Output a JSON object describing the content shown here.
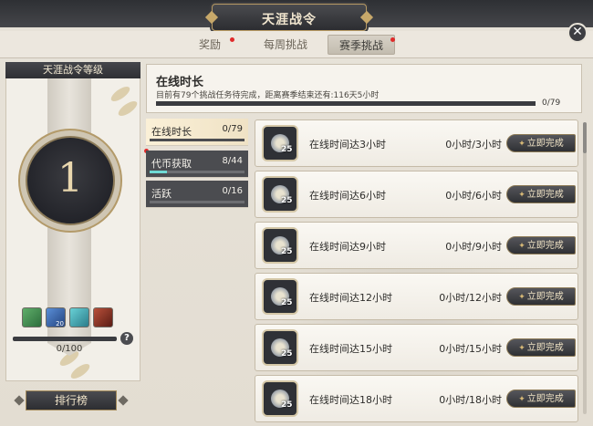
{
  "window": {
    "title": "天涯战令",
    "close_symbol": "✕"
  },
  "tabs": [
    {
      "label": "奖励",
      "active": false,
      "has_dot": true
    },
    {
      "label": "每周挑战",
      "active": false,
      "has_dot": false
    },
    {
      "label": "赛季挑战",
      "active": true,
      "has_dot": true
    }
  ],
  "level_panel": {
    "header": "天涯战令等级",
    "level": "1",
    "rewards": [
      {
        "icon": "green-scroll-icon",
        "count": ""
      },
      {
        "icon": "blue-gem-icon",
        "count": "20"
      },
      {
        "icon": "cyan-scroll-icon",
        "count": ""
      },
      {
        "icon": "red-chest-icon",
        "count": ""
      }
    ],
    "exp_text": "0/100",
    "exp_fraction": 0,
    "help_symbol": "?",
    "rank_button": "排行榜"
  },
  "summary": {
    "title": "在线时长",
    "description": "目前有79个挑战任务待完成，距离赛季结束还有:116天5小时",
    "progress_text": "0/79",
    "progress_fraction": 0
  },
  "categories": [
    {
      "label": "在线时长",
      "value": "0/79",
      "fraction": 0,
      "active": true,
      "has_dot": false
    },
    {
      "label": "代币获取",
      "value": "8/44",
      "fraction": 0.18,
      "active": false,
      "has_dot": true
    },
    {
      "label": "活跃",
      "value": "0/16",
      "fraction": 0,
      "active": false,
      "has_dot": false
    }
  ],
  "quests": [
    {
      "name": "在线时间达3小时",
      "progress": "0小时/3小时",
      "reward": "25",
      "button": "立即完成"
    },
    {
      "name": "在线时间达6小时",
      "progress": "0小时/6小时",
      "reward": "25",
      "button": "立即完成"
    },
    {
      "name": "在线时间达9小时",
      "progress": "0小时/9小时",
      "reward": "25",
      "button": "立即完成"
    },
    {
      "name": "在线时间达12小时",
      "progress": "0小时/12小时",
      "reward": "25",
      "button": "立即完成"
    },
    {
      "name": "在线时间达15小时",
      "progress": "0小时/15小时",
      "reward": "25",
      "button": "立即完成"
    },
    {
      "name": "在线时间达18小时",
      "progress": "0小时/18小时",
      "reward": "25",
      "button": "立即完成"
    }
  ],
  "colors": {
    "accent_gold": "#c7a86a",
    "dark_plate": "#2f3034",
    "category_fill": "#6fd9d3",
    "red_dot": "#e02a2a"
  }
}
